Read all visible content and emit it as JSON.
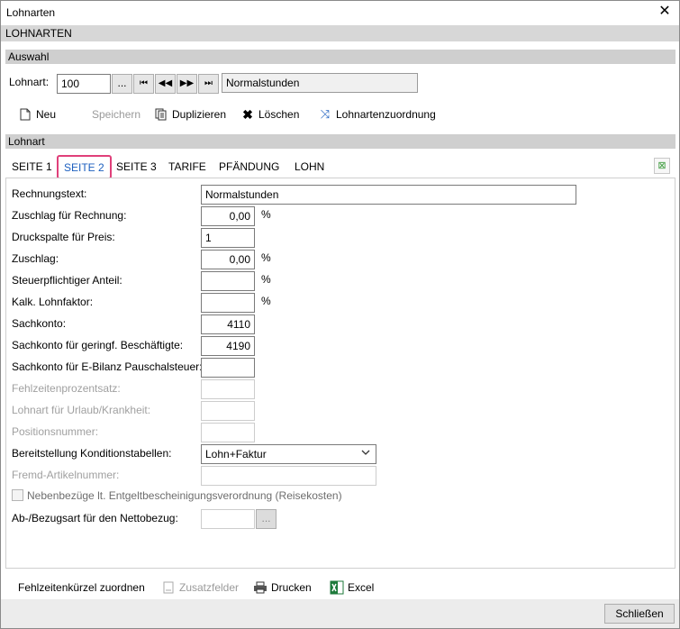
{
  "window": {
    "title": "Lohnarten",
    "close_glyph": "✕"
  },
  "banner": "LOHNARTEN",
  "auswahl": {
    "section_title": "Auswahl",
    "label": "Lohnart:",
    "code_value": "100",
    "browse_label": "...",
    "name_value": "Normalstunden"
  },
  "toolbar": {
    "neu": "Neu",
    "speichern": "Speichern",
    "duplizieren": "Duplizieren",
    "loeschen": "Löschen",
    "zuordnung": "Lohnartenzuordnung"
  },
  "lohnart_section": "Lohnart",
  "tabs": [
    "SEITE 1",
    "SEITE 2",
    "SEITE 3",
    "TARIFE",
    "PFÄNDUNG",
    "LOHN"
  ],
  "form": {
    "rechnungstext": {
      "label": "Rechnungstext:",
      "value": "Normalstunden"
    },
    "zuschlag_rechnung": {
      "label": "Zuschlag für Rechnung:",
      "value": "0,00",
      "unit": "%"
    },
    "druckspalte": {
      "label": "Druckspalte für Preis:",
      "value": "1"
    },
    "zuschlag": {
      "label": "Zuschlag:",
      "value": "0,00",
      "unit": "%"
    },
    "steuer": {
      "label": "Steuerpflichtiger Anteil:",
      "value": "",
      "unit": "%"
    },
    "kalk": {
      "label": "Kalk. Lohnfaktor:",
      "value": "",
      "unit": "%"
    },
    "sachkonto": {
      "label": "Sachkonto:",
      "value": "4110"
    },
    "sachkonto_gering": {
      "label": "Sachkonto für geringf. Beschäftigte:",
      "value": "4190"
    },
    "sachkonto_ebilanz": {
      "label": "Sachkonto für E-Bilanz Pauschalsteuer:",
      "value": ""
    },
    "fehlzeiten": {
      "label": "Fehlzeitenprozentsatz:",
      "value": ""
    },
    "lohnart_urlaub": {
      "label": "Lohnart für Urlaub/Krankheit:",
      "value": ""
    },
    "positionsnummer": {
      "label": "Positionsnummer:",
      "value": ""
    },
    "bereitstellung": {
      "label": "Bereitstellung Konditionstabellen:",
      "value": "Lohn+Faktur"
    },
    "fremd": {
      "label": "Fremd-Artikelnummer:",
      "value": ""
    },
    "nebenbezuege": {
      "label": "Nebenbezüge lt. Entgeltbescheinigungsverordnung (Reisekosten)"
    },
    "bezugsart": {
      "label": "Ab-/Bezugsart für den Nettobezug:",
      "value": "",
      "button": "..."
    }
  },
  "bottom_toolbar": {
    "fehlzeiten": "Fehlzeitenkürzel zuordnen",
    "zusatz": "Zusatzfelder",
    "drucken": "Drucken",
    "excel": "Excel"
  },
  "footer": {
    "schliessen": "Schließen"
  }
}
